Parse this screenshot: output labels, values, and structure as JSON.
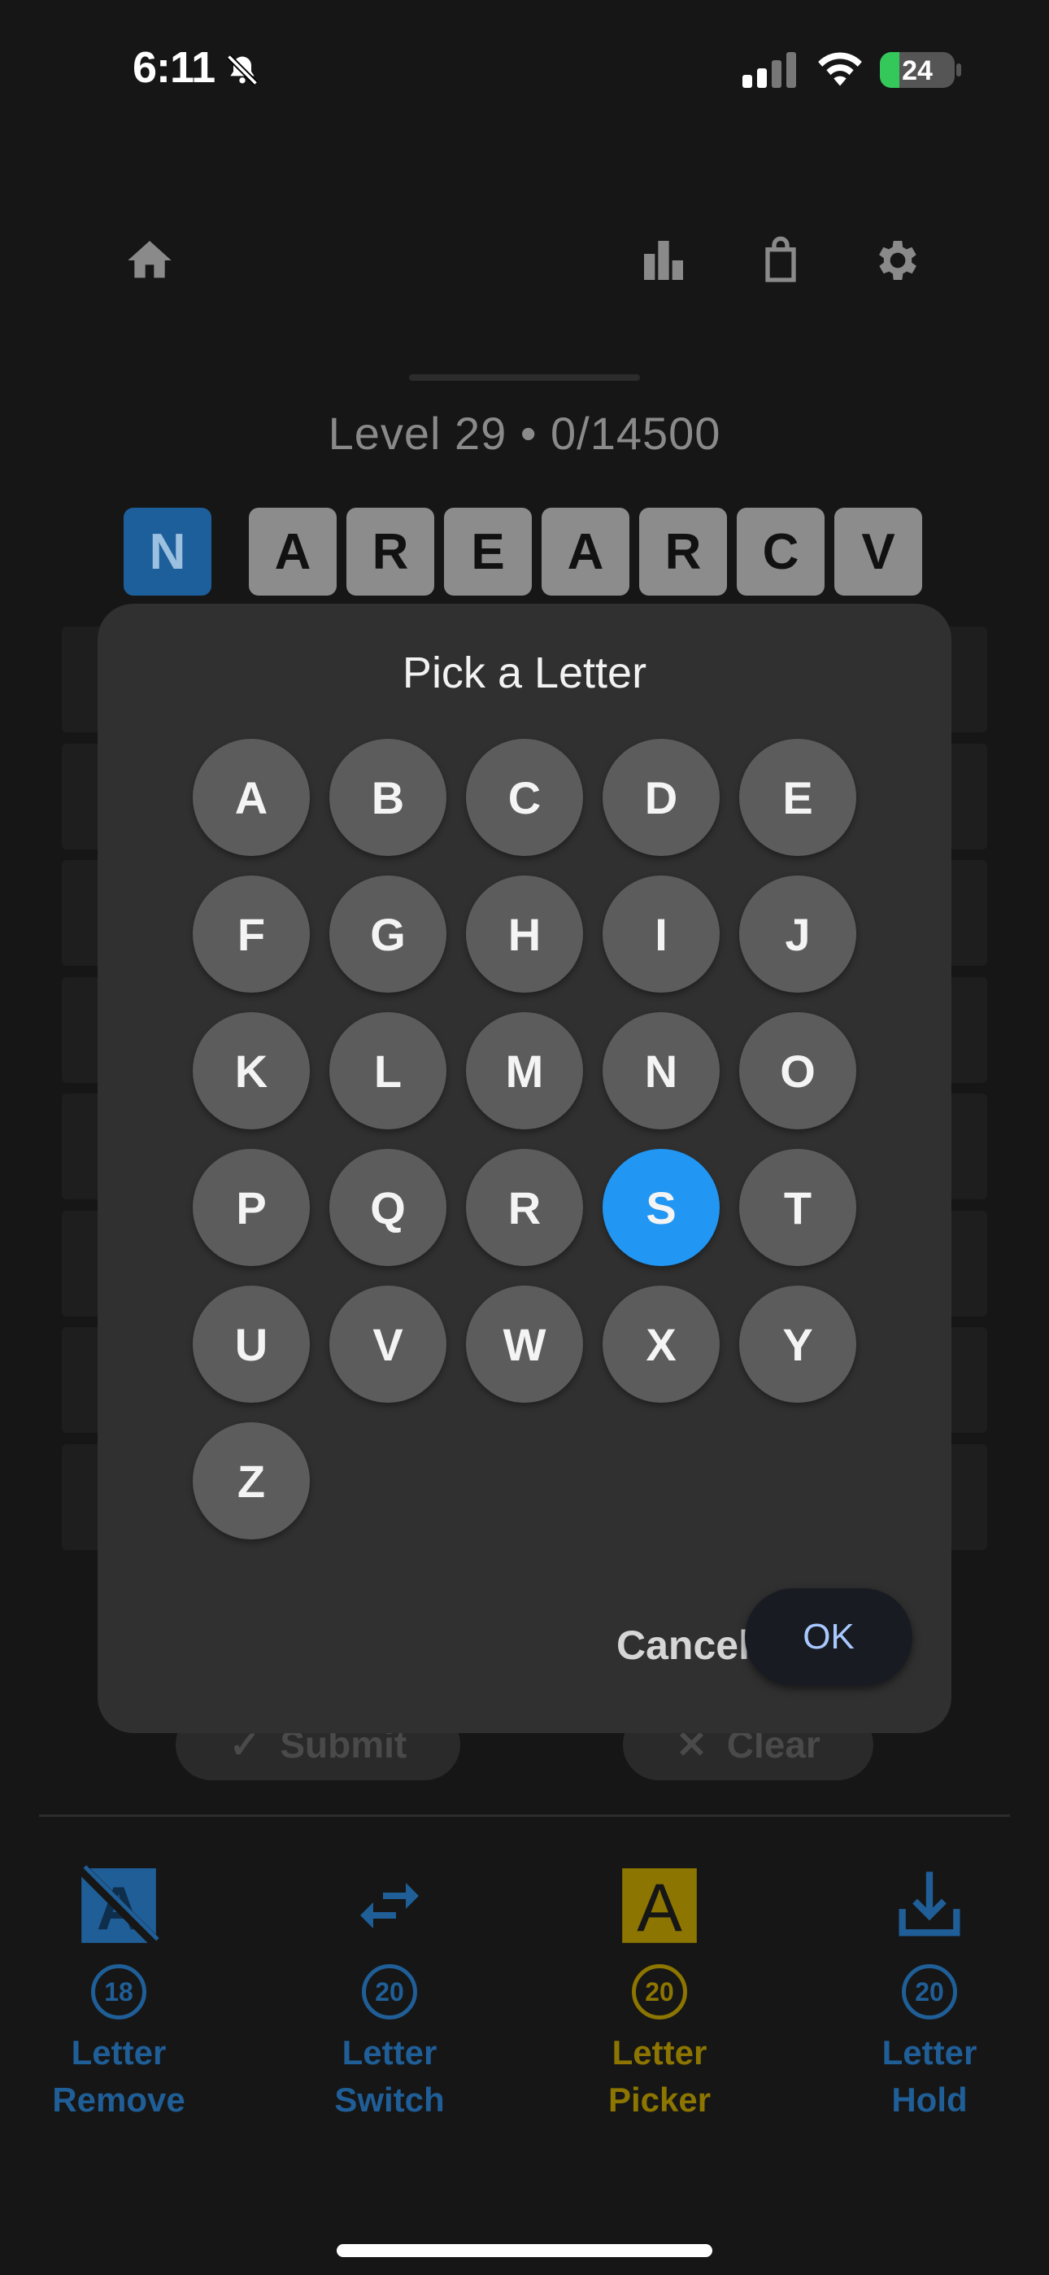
{
  "status_bar": {
    "time": "6:11",
    "battery": "24"
  },
  "nav": {
    "icons": [
      "home-icon",
      "leaderboard-icon",
      "shop-bag-icon",
      "settings-gear-icon"
    ]
  },
  "level": {
    "text": "Level 29 • 0/14500"
  },
  "word_tiles": [
    "N",
    "A",
    "R",
    "E",
    "A",
    "R",
    "C",
    "V"
  ],
  "actions": {
    "submit_label": "Submit",
    "clear_label": "Clear"
  },
  "powerups": [
    {
      "count": "18",
      "label": "Letter\nRemove",
      "icon": "letter-remove-icon",
      "color": "#1f5e97"
    },
    {
      "count": "20",
      "label": "Letter\nSwitch",
      "icon": "swap-arrows-icon",
      "color": "#1f5e97"
    },
    {
      "count": "20",
      "label": "Letter\nPicker",
      "icon": "letter-picker-icon",
      "color": "#8c7500"
    },
    {
      "count": "20",
      "label": "Letter\nHold",
      "icon": "download-hold-icon",
      "color": "#1f5e97"
    }
  ],
  "dialog": {
    "title": "Pick a Letter",
    "letters": [
      "A",
      "B",
      "C",
      "D",
      "E",
      "F",
      "G",
      "H",
      "I",
      "J",
      "K",
      "L",
      "M",
      "N",
      "O",
      "P",
      "Q",
      "R",
      "S",
      "T",
      "U",
      "V",
      "W",
      "X",
      "Y",
      "Z"
    ],
    "selected": "S",
    "cancel_label": "Cancel",
    "ok_label": "OK"
  },
  "colors": {
    "accent": "#2196f3",
    "background": "#161616",
    "dialog": "#303030"
  }
}
